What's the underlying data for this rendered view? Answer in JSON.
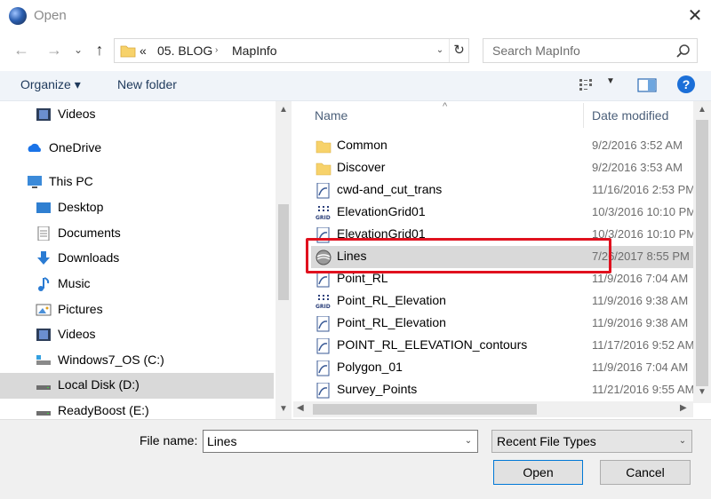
{
  "window": {
    "title": "Open"
  },
  "nav": {
    "back": "←",
    "forward": "→",
    "recent": "⌄",
    "up": "↑"
  },
  "address": {
    "overflow": "«",
    "crumbs": [
      "05. BLOG",
      "MapInfo"
    ],
    "dropdown": "⌄",
    "refresh": "↻"
  },
  "search": {
    "placeholder": "Search MapInfo"
  },
  "toolbar": {
    "organize": "Organize ▾",
    "new_folder": "New folder",
    "help": "?"
  },
  "sidebar": {
    "items": [
      {
        "label": "Videos",
        "icon": "videos-icon",
        "selected": false
      },
      {
        "label": "OneDrive",
        "icon": "onedrive-icon",
        "selected": false
      },
      {
        "label": "This PC",
        "icon": "computer-icon",
        "selected": false
      },
      {
        "label": "Desktop",
        "icon": "desktop-icon",
        "selected": false
      },
      {
        "label": "Documents",
        "icon": "documents-icon",
        "selected": false
      },
      {
        "label": "Downloads",
        "icon": "downloads-icon",
        "selected": false
      },
      {
        "label": "Music",
        "icon": "music-icon",
        "selected": false
      },
      {
        "label": "Pictures",
        "icon": "pictures-icon",
        "selected": false
      },
      {
        "label": "Videos",
        "icon": "videos-icon",
        "selected": false
      },
      {
        "label": "Windows7_OS (C:)",
        "icon": "drive-icon",
        "selected": false
      },
      {
        "label": "Local Disk (D:)",
        "icon": "drive-icon",
        "selected": true
      },
      {
        "label": "ReadyBoost (E:)",
        "icon": "drive-icon",
        "selected": false
      }
    ]
  },
  "filelist": {
    "columns": [
      "Name",
      "Date modified"
    ],
    "files": [
      {
        "name": "Common",
        "date": "9/2/2016 3:52 AM",
        "icon": "folder-icon"
      },
      {
        "name": "Discover",
        "date": "9/2/2016 3:53 AM",
        "icon": "folder-icon"
      },
      {
        "name": "cwd-and_cut_trans",
        "date": "11/16/2016 2:53 PM",
        "icon": "mapinfo-file-icon"
      },
      {
        "name": "ElevationGrid01",
        "date": "10/3/2016 10:10 PM",
        "icon": "grid-file-icon"
      },
      {
        "name": "ElevationGrid01",
        "date": "10/3/2016 10:10 PM",
        "icon": "mapinfo-file-icon"
      },
      {
        "name": "Lines",
        "date": "7/26/2017 8:55 PM",
        "icon": "mapinfo-workspace-icon",
        "selected": true
      },
      {
        "name": "Point_RL",
        "date": "11/9/2016 7:04 AM",
        "icon": "mapinfo-file-icon"
      },
      {
        "name": "Point_RL_Elevation",
        "date": "11/9/2016 9:38 AM",
        "icon": "grid-file-icon"
      },
      {
        "name": "Point_RL_Elevation",
        "date": "11/9/2016 9:38 AM",
        "icon": "mapinfo-file-icon"
      },
      {
        "name": "POINT_RL_ELEVATION_contours",
        "date": "11/17/2016 9:52 AM",
        "icon": "mapinfo-file-icon"
      },
      {
        "name": "Polygon_01",
        "date": "11/9/2016 7:04 AM",
        "icon": "mapinfo-file-icon"
      },
      {
        "name": "Survey_Points",
        "date": "11/21/2016 9:55 AM",
        "icon": "mapinfo-file-icon"
      }
    ]
  },
  "bottom": {
    "file_name_label": "File name:",
    "file_name_value": "Lines",
    "file_type_value": "Recent File Types",
    "open_label": "Open",
    "cancel_label": "Cancel"
  },
  "colors": {
    "highlight": "#e0111e",
    "accent": "#0078d7",
    "folder": "#f7d26a"
  }
}
